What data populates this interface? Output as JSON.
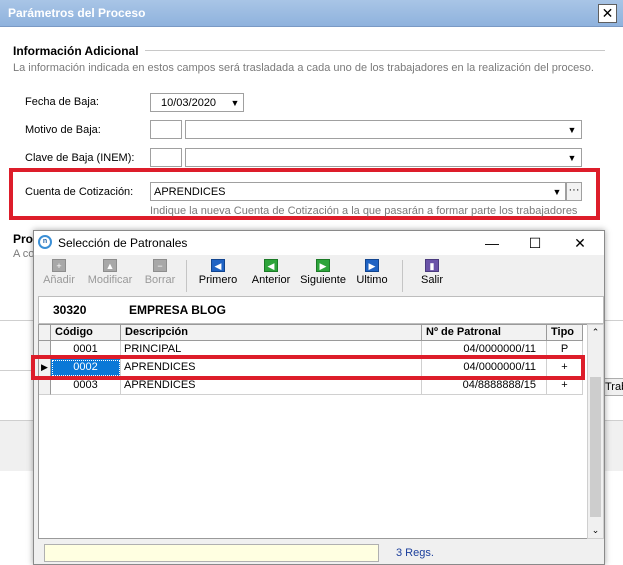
{
  "outer": {
    "title": "Parámetros del Proceso",
    "close": "✕",
    "section_title": "Información Adicional",
    "section_desc": "La información indicada en estos campos será trasladada a cada uno de los trabajadores en la realización del proceso.",
    "fecha_label": "Fecha de Baja:",
    "fecha_value": "10/03/2020",
    "motivo_label": "Motivo de Baja:",
    "clave_label": "Clave de Baja (INEM):",
    "cuenta_label": "Cuenta de Cotización:",
    "cuenta_value": "APRENDICES",
    "cuenta_button": "···",
    "cuenta_hint": "Indique la nueva Cuenta de Cotización a la que pasarán a formar parte los trabajadores",
    "proc_partial": "Pro",
    "ac_partial": "A co",
    "tra_partial": "Trab"
  },
  "dialog": {
    "title": "Selección de Patronales",
    "minimize": "—",
    "maximize": "☐",
    "close": "✕",
    "toolbar": {
      "anadir": "Añadir",
      "modificar": "Modificar",
      "borrar": "Borrar",
      "primero": "Primero",
      "anterior": "Anterior",
      "siguiente": "Siguiente",
      "ultimo": "Ultimo",
      "salir": "Salir"
    },
    "company_code": "30320",
    "company_name": "EMPRESA BLOG",
    "grid": {
      "headers": {
        "codigo": "Código",
        "descripcion": "Descripción",
        "patronal": "Nº de Patronal",
        "tipo": "Tipo"
      },
      "rows": [
        {
          "codigo": "0001",
          "descripcion": "PRINCIPAL",
          "patronal": "04/0000000/11",
          "tipo": "P"
        },
        {
          "codigo": "0002",
          "descripcion": "APRENDICES",
          "patronal": "04/0000000/11",
          "tipo": "+"
        },
        {
          "codigo": "0003",
          "descripcion": "APRENDICES",
          "patronal": "04/8888888/15",
          "tipo": "+"
        }
      ],
      "selected_index": 1
    },
    "status_count": "3 Regs."
  }
}
